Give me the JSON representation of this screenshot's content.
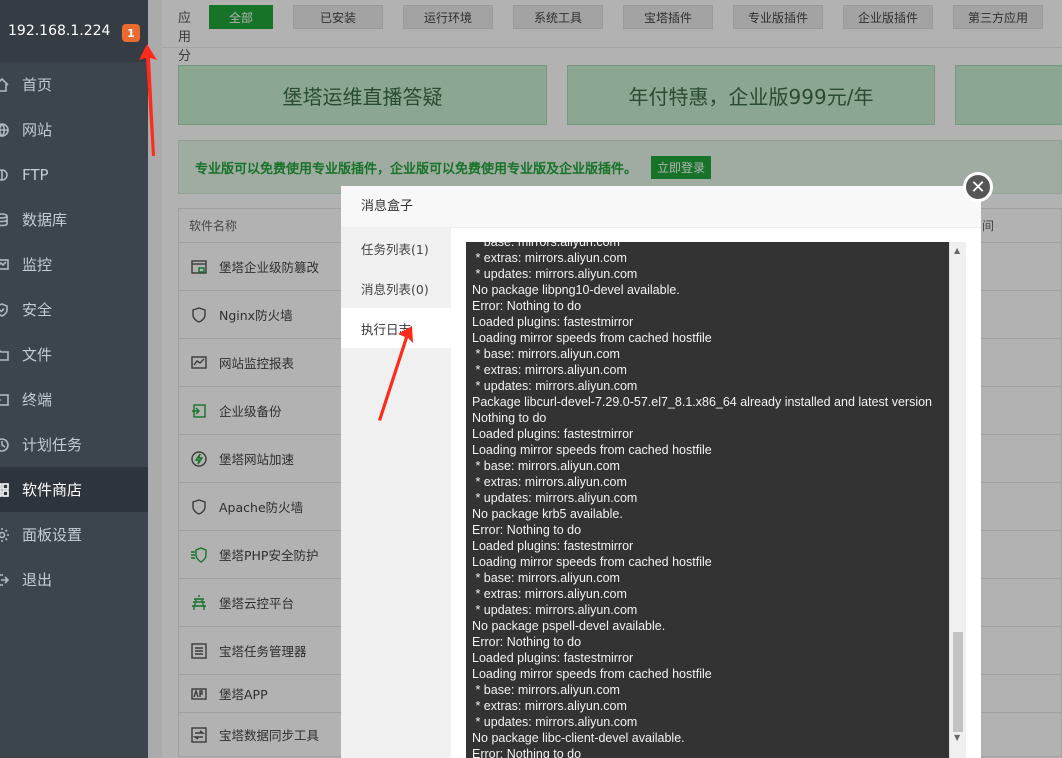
{
  "sidebar": {
    "ip": "192.168.1.224",
    "badge": "1",
    "items": [
      {
        "label": "首页",
        "icon": "home-icon"
      },
      {
        "label": "网站",
        "icon": "globe-icon"
      },
      {
        "label": "FTP",
        "icon": "ftp-icon"
      },
      {
        "label": "数据库",
        "icon": "database-icon"
      },
      {
        "label": "监控",
        "icon": "monitor-icon"
      },
      {
        "label": "安全",
        "icon": "shield-icon"
      },
      {
        "label": "文件",
        "icon": "folder-icon"
      },
      {
        "label": "终端",
        "icon": "terminal-icon"
      },
      {
        "label": "计划任务",
        "icon": "clock-icon"
      },
      {
        "label": "软件商店",
        "icon": "grid-icon"
      },
      {
        "label": "面板设置",
        "icon": "gear-icon"
      },
      {
        "label": "退出",
        "icon": "logout-icon"
      }
    ]
  },
  "categories": {
    "label": "应用分类",
    "items": [
      "全部",
      "已安装",
      "运行环境",
      "系统工具",
      "宝塔插件",
      "专业版插件",
      "企业版插件",
      "第三方应用"
    ]
  },
  "promos": [
    "堡塔运维直播答疑",
    "年付特惠，企业版999元/年"
  ],
  "notice": {
    "text": "专业版可以免费使用专业版插件，企业版可以免费使用专业版及企业版插件。",
    "login": "立即登录"
  },
  "table": {
    "header": "软件名称",
    "header_right": "间",
    "rows": [
      {
        "name": "堡塔企业级防篡改",
        "icon": "lock-page-icon"
      },
      {
        "name": "Nginx防火墙",
        "icon": "waf-icon"
      },
      {
        "name": "网站监控报表",
        "icon": "chart-icon"
      },
      {
        "name": "企业级备份",
        "icon": "backup-icon"
      },
      {
        "name": "堡塔网站加速",
        "icon": "lightning-icon"
      },
      {
        "name": "Apache防火墙",
        "icon": "waf-icon"
      },
      {
        "name": "堡塔PHP安全防护",
        "icon": "php-shield-icon"
      },
      {
        "name": "堡塔云控平台",
        "icon": "pagoda-icon"
      },
      {
        "name": "宝塔任务管理器",
        "icon": "task-list-icon"
      },
      {
        "name": "堡塔APP",
        "icon": "app-icon"
      },
      {
        "name": "宝塔数据同步工具",
        "icon": "sync-icon"
      }
    ]
  },
  "modal": {
    "title": "消息盒子",
    "tabs": [
      "任务列表(1)",
      "消息列表(0)",
      "执行日志"
    ],
    "log_lines": [
      " * base: mirrors.aliyun.com",
      " * extras: mirrors.aliyun.com",
      " * updates: mirrors.aliyun.com",
      "No package libpng10-devel available.",
      "Error: Nothing to do",
      "Loaded plugins: fastestmirror",
      "Loading mirror speeds from cached hostfile",
      " * base: mirrors.aliyun.com",
      " * extras: mirrors.aliyun.com",
      " * updates: mirrors.aliyun.com",
      "Package libcurl-devel-7.29.0-57.el7_8.1.x86_64 already installed and latest version",
      "Nothing to do",
      "Loaded plugins: fastestmirror",
      "Loading mirror speeds from cached hostfile",
      " * base: mirrors.aliyun.com",
      " * extras: mirrors.aliyun.com",
      " * updates: mirrors.aliyun.com",
      "No package krb5 available.",
      "Error: Nothing to do",
      "Loaded plugins: fastestmirror",
      "Loading mirror speeds from cached hostfile",
      " * base: mirrors.aliyun.com",
      " * extras: mirrors.aliyun.com",
      " * updates: mirrors.aliyun.com",
      "No package pspell-devel available.",
      "Error: Nothing to do",
      "Loaded plugins: fastestmirror",
      "Loading mirror speeds from cached hostfile",
      " * base: mirrors.aliyun.com",
      " * extras: mirrors.aliyun.com",
      " * updates: mirrors.aliyun.com",
      "No package libc-client-devel available.",
      "Error: Nothing to do"
    ]
  },
  "colors": {
    "accent": "#20a53a",
    "sidebar": "#3c444d",
    "badge": "#e96b2f",
    "arrow": "#ff2a1a"
  }
}
